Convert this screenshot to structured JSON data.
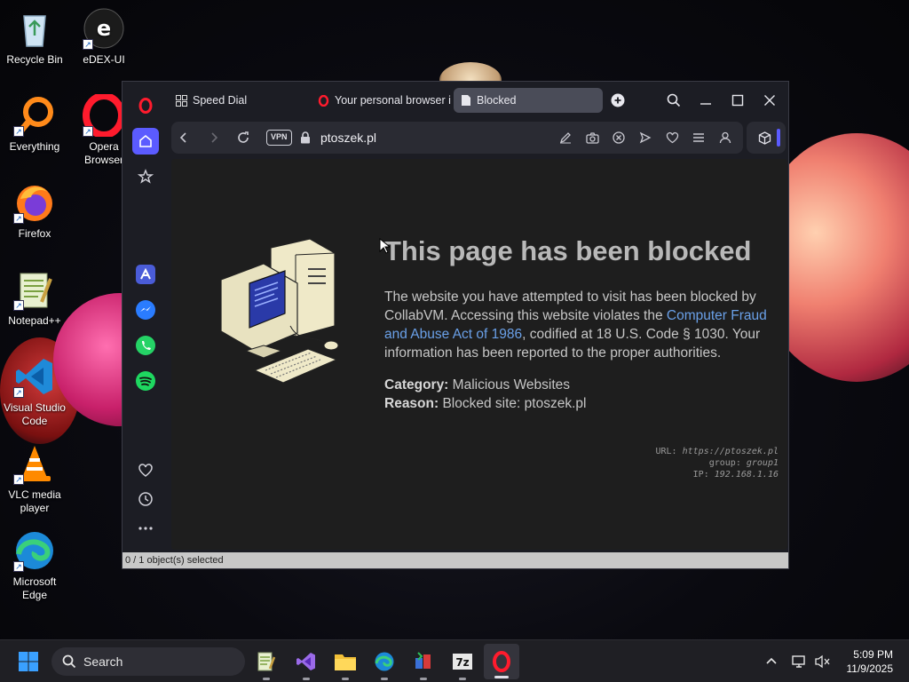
{
  "desktop": {
    "icons": [
      {
        "label": "Recycle Bin"
      },
      {
        "label": "eDEX-UI"
      },
      {
        "label": "Everything"
      },
      {
        "label": "Opera Browser"
      },
      {
        "label": "Firefox"
      },
      {
        "label": "Notepad++"
      },
      {
        "label": "Visual Studio Code"
      },
      {
        "label": "VLC media player"
      },
      {
        "label": "Microsoft Edge"
      }
    ]
  },
  "browser": {
    "tabs": [
      {
        "label": "Speed Dial"
      },
      {
        "label": "Your personal browser is"
      },
      {
        "label": "Blocked"
      }
    ],
    "address": {
      "vpn_label": "VPN",
      "url": "ptoszek.pl"
    },
    "page": {
      "headline": "This page has been blocked",
      "para_start": "The website you have attempted to visit has been blocked by CollabVM. Accessing this website violates the ",
      "para_link": "Computer Fraud and Abuse Act of 1986",
      "para_end": ", codified at 18 U.S. Code § 1030. Your information has been reported to the proper authorities.",
      "category_label": "Category:",
      "category_value": "Malicious Websites",
      "reason_label": "Reason:",
      "reason_value": "Blocked site: ptoszek.pl",
      "tech": {
        "url_label": "URL:",
        "url_value": "https://ptoszek.pl",
        "group_label": "group:",
        "group_value": "group1",
        "ip_label": "IP:",
        "ip_value": "192.168.1.16"
      }
    },
    "status": "0 / 1 object(s) selected"
  },
  "taskbar": {
    "search_label": "Search",
    "time": "5:09 PM",
    "date": "11/9/2025"
  },
  "colors": {
    "opera_red": "#ff1b2d",
    "accent_blue": "#5b5bff",
    "link": "#6aa0e8"
  }
}
